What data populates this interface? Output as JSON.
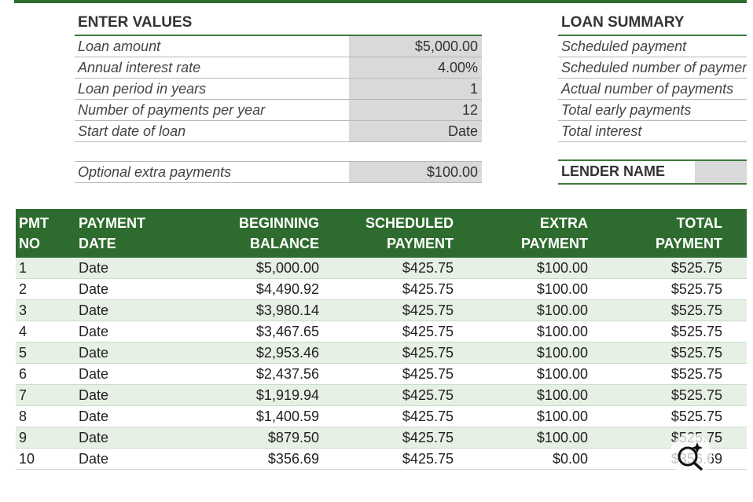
{
  "enter_values": {
    "title": "ENTER VALUES",
    "rows": [
      {
        "label": "Loan amount",
        "value": "$5,000.00"
      },
      {
        "label": "Annual interest rate",
        "value": "4.00%"
      },
      {
        "label": "Loan period in years",
        "value": "1"
      },
      {
        "label": "Number of payments per year",
        "value": "12"
      },
      {
        "label": "Start date of loan",
        "value": "Date"
      }
    ],
    "extra": {
      "label": "Optional extra payments",
      "value": "$100.00"
    }
  },
  "loan_summary": {
    "title": "LOAN SUMMARY",
    "rows": [
      "Scheduled payment",
      "Scheduled number of payments",
      "Actual number of payments",
      "Total early payments",
      "Total interest"
    ],
    "lender_label": "LENDER NAME"
  },
  "table": {
    "headers": [
      [
        "PMT",
        "NO"
      ],
      [
        "PAYMENT",
        "DATE"
      ],
      [
        "BEGINNING",
        "BALANCE"
      ],
      [
        "SCHEDULED",
        "PAYMENT"
      ],
      [
        "EXTRA",
        "PAYMENT"
      ],
      [
        "TOTAL",
        "PAYMENT"
      ]
    ],
    "rows": [
      [
        "1",
        "Date",
        "$5,000.00",
        "$425.75",
        "$100.00",
        "$525.75"
      ],
      [
        "2",
        "Date",
        "$4,490.92",
        "$425.75",
        "$100.00",
        "$525.75"
      ],
      [
        "3",
        "Date",
        "$3,980.14",
        "$425.75",
        "$100.00",
        "$525.75"
      ],
      [
        "4",
        "Date",
        "$3,467.65",
        "$425.75",
        "$100.00",
        "$525.75"
      ],
      [
        "5",
        "Date",
        "$2,953.46",
        "$425.75",
        "$100.00",
        "$525.75"
      ],
      [
        "6",
        "Date",
        "$2,437.56",
        "$425.75",
        "$100.00",
        "$525.75"
      ],
      [
        "7",
        "Date",
        "$1,919.94",
        "$425.75",
        "$100.00",
        "$525.75"
      ],
      [
        "8",
        "Date",
        "$1,400.59",
        "$425.75",
        "$100.00",
        "$525.75"
      ],
      [
        "9",
        "Date",
        "$879.50",
        "$425.75",
        "$100.00",
        "$525.75"
      ],
      [
        "10",
        "Date",
        "$356.69",
        "$425.75",
        "$0.00",
        "$356.69"
      ]
    ]
  },
  "colors": {
    "header_green": "#2e6b2e",
    "row_tint": "#e6f0e4",
    "input_gray": "#d9d9d9"
  },
  "icons": {
    "zoom": "visual-search-icon"
  }
}
